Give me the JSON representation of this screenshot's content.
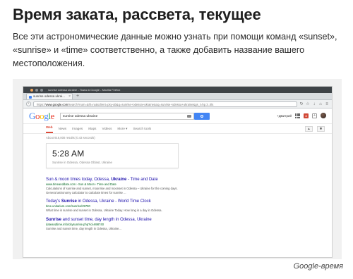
{
  "article": {
    "title": "Время заката, рассвета, текущее",
    "body": "Все эти астрономические данные можно узнать при помощи команд «sunset», «sunrise» и «time» соответственно, а также добавить название вашего местоположения.",
    "caption": "Google-время"
  },
  "browser": {
    "window_title": "sunrise odessa ukraine - Поиск в Google - Mozilla Firefox",
    "tab_label": "sunrise odessa ukrai...",
    "url_prefix": "https://",
    "url_host": "www.google.com",
    "url_rest": "/search?num=&hl=ru&sclient=psy-ab&q=sunrise+odessa+ukraine&oq=sunrise+odessa+ukraine&gs_l=hp.3..0l4"
  },
  "google": {
    "search_value": "sunrise odessa ukraine",
    "user_name": "+Дмитрий",
    "notifications": "3",
    "tabs": [
      "Web",
      "News",
      "Images",
      "Maps",
      "Videos",
      "More ▾",
      "Search tools"
    ],
    "result_count": "About 916,000 results (0.43 seconds)",
    "answer": {
      "time": "5:28 AM",
      "subtitle": "Sunrise in Odessa, Odessa Oblast, Ukraine"
    },
    "results": [
      {
        "title_pre": "Sun & moon times today, Odessa, ",
        "title_bold": "Ukraine",
        "title_post": " - Time and Date",
        "url": "www.timeanddate.com › Sun & Moon › Time and Date",
        "snippet": "Calculations of sunrise and sunset, moonrise and moonset in Odessa – Ukraine for the coming days. General astronomy calculator to calculate times for sunrise ..."
      },
      {
        "title_pre": "Today's ",
        "title_bold": "Sunrise",
        "title_post": " in Odessa, Ukraine - World Time Clock",
        "url": "time.unitarium.com/sunrise/29790",
        "snippet": "What time is sunrise and sunset in Odessa, Ukraine Today. How long is a day in Odessa."
      },
      {
        "title_pre": "",
        "title_bold": "Sunrise",
        "title_post": " and sunset time, day length in Odessa, Ukraine",
        "url": "dateandtime.info/citysunrise.php?id=698740",
        "snippet": "Sunrise and sunset time, day length in Odessa, Ukraine..."
      }
    ]
  }
}
